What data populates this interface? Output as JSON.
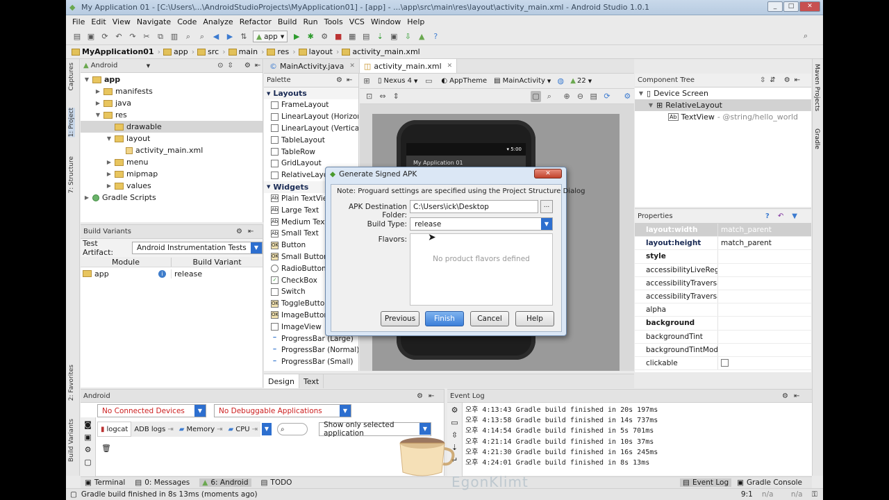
{
  "window": {
    "title": "My Application 01 - [C:\\Users\\...\\AndroidStudioProjects\\MyApplication01] - [app] - ...\\app\\src\\main\\res\\layout\\activity_main.xml - Android Studio 1.0.1"
  },
  "menu": [
    "File",
    "Edit",
    "View",
    "Navigate",
    "Code",
    "Analyze",
    "Refactor",
    "Build",
    "Run",
    "Tools",
    "VCS",
    "Window",
    "Help"
  ],
  "toolbar": {
    "run_config": "app"
  },
  "breadcrumb": [
    "MyApplication01",
    "app",
    "src",
    "main",
    "res",
    "layout",
    "activity_main.xml"
  ],
  "left_strip": {
    "captures": "Captures",
    "project": "1: Project",
    "structure": "7: Structure",
    "favorites": "2: Favorites",
    "build_variants": "Build Variants"
  },
  "project": {
    "view": "Android",
    "tree": [
      {
        "label": "app",
        "level": 0,
        "arrow": "▼"
      },
      {
        "label": "manifests",
        "level": 1,
        "arrow": "▶"
      },
      {
        "label": "java",
        "level": 1,
        "arrow": "▶"
      },
      {
        "label": "res",
        "level": 1,
        "arrow": "▼"
      },
      {
        "label": "drawable",
        "level": 2,
        "arrow": ""
      },
      {
        "label": "layout",
        "level": 2,
        "arrow": "▼"
      },
      {
        "label": "activity_main.xml",
        "level": 3,
        "arrow": ""
      },
      {
        "label": "menu",
        "level": 2,
        "arrow": "▶"
      },
      {
        "label": "mipmap",
        "level": 2,
        "arrow": "▶"
      },
      {
        "label": "values",
        "level": 2,
        "arrow": "▶"
      },
      {
        "label": "Gradle Scripts",
        "level": 0,
        "arrow": "▶"
      }
    ]
  },
  "build_variants": {
    "title": "Build Variants",
    "test_artifact_label": "Test Artifact:",
    "test_artifact_value": "Android Instrumentation Tests",
    "col_module": "Module",
    "col_variant": "Build Variant",
    "module": "app",
    "variant": "release"
  },
  "editor_tabs": [
    "MainActivity.java",
    "activity_main.xml"
  ],
  "palette": {
    "title": "Palette",
    "layouts_header": "Layouts",
    "layouts": [
      "FrameLayout",
      "LinearLayout (Horizontal)",
      "LinearLayout (Vertical)",
      "TableLayout",
      "TableRow",
      "GridLayout",
      "RelativeLayout"
    ],
    "widgets_header": "Widgets",
    "widgets": [
      "Plain TextView",
      "Large Text",
      "Medium Text",
      "Small Text",
      "Button",
      "Small Button",
      "RadioButton",
      "CheckBox",
      "Switch",
      "ToggleButton",
      "ImageButton",
      "ImageView",
      "ProgressBar (Large)",
      "ProgressBar (Normal)",
      "ProgressBar (Small)"
    ]
  },
  "design_toolbar": {
    "device": "Nexus 4",
    "theme": "AppTheme",
    "activity": "MainActivity",
    "api": "22"
  },
  "design_tabs": [
    "Design",
    "Text"
  ],
  "preview": {
    "time": "5:00",
    "app_title": "My Application 01"
  },
  "component_tree": {
    "title": "Component Tree",
    "items": [
      "Device Screen",
      "RelativeLayout",
      "TextView"
    ],
    "textview_hint": "- @string/hello_world"
  },
  "properties": {
    "title": "Properties",
    "rows": [
      {
        "k": "layout:width",
        "v": "match_parent",
        "bold": true
      },
      {
        "k": "layout:height",
        "v": "match_parent",
        "bold": true
      },
      {
        "k": "style",
        "v": "",
        "bold": true
      },
      {
        "k": "accessibilityLiveRegion",
        "v": ""
      },
      {
        "k": "accessibilityTraversalAfte",
        "v": ""
      },
      {
        "k": "accessibilityTraversalBefc",
        "v": ""
      },
      {
        "k": "alpha",
        "v": ""
      },
      {
        "k": "background",
        "v": "",
        "bold": true
      },
      {
        "k": "backgroundTint",
        "v": ""
      },
      {
        "k": "backgroundTintMode",
        "v": ""
      },
      {
        "k": "clickable",
        "v": "",
        "checkbox": true
      }
    ]
  },
  "right_strip": {
    "maven": "Maven Projects",
    "gradle": "Gradle"
  },
  "dialog": {
    "title": "Generate Signed APK",
    "note": "Note: Proguard settings are specified using the Project Structure Dialog",
    "dest_label": "APK Destination Folder:",
    "dest_value": "C:\\Users\\ick\\Desktop",
    "browse": "...",
    "build_type_label": "Build Type:",
    "build_type_value": "release",
    "flavors_label": "Flavors:",
    "no_flavors": "No product flavors defined",
    "previous": "Previous",
    "finish": "Finish",
    "cancel": "Cancel",
    "help": "Help"
  },
  "android_panel": {
    "title": "Android",
    "devices": "No Connected Devices",
    "apps": "No Debuggable Applications",
    "tabs": [
      "logcat",
      "ADB logs",
      "Memory",
      "CPU"
    ],
    "filter": "Show only selected application"
  },
  "event_log": {
    "title": "Event Log",
    "lines": [
      "오후 4:13:43 Gradle build finished in 20s 197ms",
      "오후 4:13:58 Gradle build finished in 14s 737ms",
      "오후 4:14:54 Gradle build finished in 5s 701ms",
      "오후 4:21:14 Gradle build finished in 10s 37ms",
      "오후 4:21:30 Gradle build finished in 16s 245ms",
      "오후 4:24:01 Gradle build finished in 8s 13ms"
    ]
  },
  "bottom_tabs": [
    "Terminal",
    "0: Messages",
    "6: Android",
    "TODO"
  ],
  "bottom_right_tabs": [
    "Event Log",
    "Gradle Console"
  ],
  "status": {
    "message": "Gradle build finished in 8s 13ms (moments ago)",
    "position": "9:1",
    "na1": "n/a",
    "na2": "n/a"
  },
  "watermark": "EgonKlimt",
  "colors": {
    "accent": "#2d6fcf",
    "error_text": "#cc1f1f",
    "title_blue": "#c9d9ea"
  }
}
